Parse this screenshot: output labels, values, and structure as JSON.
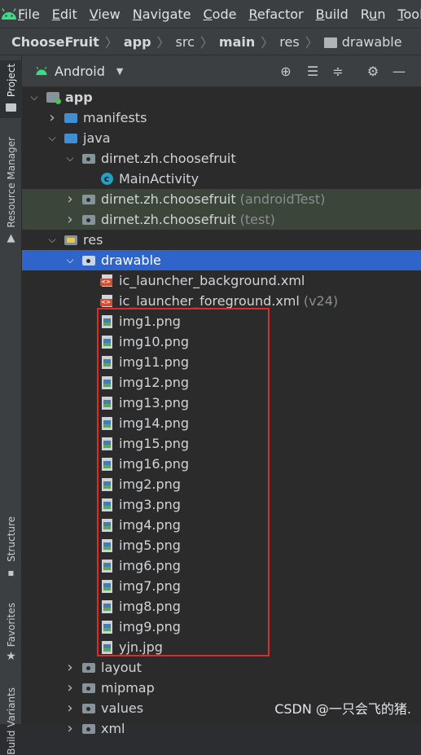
{
  "menubar": {
    "items": [
      {
        "pre": "",
        "u": "F",
        "post": "ile"
      },
      {
        "pre": "",
        "u": "E",
        "post": "dit"
      },
      {
        "pre": "",
        "u": "V",
        "post": "iew"
      },
      {
        "pre": "",
        "u": "N",
        "post": "avigate"
      },
      {
        "pre": "",
        "u": "C",
        "post": "ode"
      },
      {
        "pre": "",
        "u": "R",
        "post": "efactor"
      },
      {
        "pre": "",
        "u": "B",
        "post": "uild"
      },
      {
        "pre": "R",
        "u": "u",
        "post": "n"
      },
      {
        "pre": "",
        "u": "T",
        "post": "ools"
      }
    ]
  },
  "breadcrumb": [
    "ChooseFruit",
    "app",
    "src",
    "main",
    "res",
    "drawable"
  ],
  "side_tabs": {
    "project": "Project",
    "resource_manager": "Resource Manager",
    "structure": "Structure",
    "favorites": "Favorites",
    "variants": "Build Variants"
  },
  "project_view": {
    "selector": "Android"
  },
  "tree": [
    {
      "label": "app",
      "hint": "",
      "indent": 0,
      "arrow": "down",
      "icon": "module",
      "bold": true
    },
    {
      "label": "manifests",
      "hint": "",
      "indent": 1,
      "arrow": "right",
      "icon": "folder-blue"
    },
    {
      "label": "java",
      "hint": "",
      "indent": 1,
      "arrow": "down",
      "icon": "folder-blue"
    },
    {
      "label": "dirnet.zh.choosefruit",
      "hint": "",
      "indent": 2,
      "arrow": "down",
      "icon": "package"
    },
    {
      "label": "MainActivity",
      "hint": "",
      "indent": 3,
      "arrow": "none",
      "icon": "class"
    },
    {
      "label": "dirnet.zh.choosefruit",
      "hint": "(androidTest)",
      "indent": 2,
      "arrow": "right",
      "icon": "package",
      "test": true
    },
    {
      "label": "dirnet.zh.choosefruit",
      "hint": "(test)",
      "indent": 2,
      "arrow": "right",
      "icon": "package",
      "test": true
    },
    {
      "label": "res",
      "hint": "",
      "indent": 1,
      "arrow": "down",
      "icon": "folder-res"
    },
    {
      "label": "drawable",
      "hint": "",
      "indent": 2,
      "arrow": "down",
      "icon": "package",
      "selected": true
    },
    {
      "label": "ic_launcher_background.xml",
      "hint": "",
      "indent": 3,
      "arrow": "none",
      "icon": "xml"
    },
    {
      "label": "ic_launcher_foreground.xml",
      "hint": "(v24)",
      "indent": 3,
      "arrow": "none",
      "icon": "xml"
    },
    {
      "label": "img1.png",
      "hint": "",
      "indent": 3,
      "arrow": "none",
      "icon": "image"
    },
    {
      "label": "img10.png",
      "hint": "",
      "indent": 3,
      "arrow": "none",
      "icon": "image"
    },
    {
      "label": "img11.png",
      "hint": "",
      "indent": 3,
      "arrow": "none",
      "icon": "image"
    },
    {
      "label": "img12.png",
      "hint": "",
      "indent": 3,
      "arrow": "none",
      "icon": "image"
    },
    {
      "label": "img13.png",
      "hint": "",
      "indent": 3,
      "arrow": "none",
      "icon": "image"
    },
    {
      "label": "img14.png",
      "hint": "",
      "indent": 3,
      "arrow": "none",
      "icon": "image"
    },
    {
      "label": "img15.png",
      "hint": "",
      "indent": 3,
      "arrow": "none",
      "icon": "image"
    },
    {
      "label": "img16.png",
      "hint": "",
      "indent": 3,
      "arrow": "none",
      "icon": "image"
    },
    {
      "label": "img2.png",
      "hint": "",
      "indent": 3,
      "arrow": "none",
      "icon": "image"
    },
    {
      "label": "img3.png",
      "hint": "",
      "indent": 3,
      "arrow": "none",
      "icon": "image"
    },
    {
      "label": "img4.png",
      "hint": "",
      "indent": 3,
      "arrow": "none",
      "icon": "image"
    },
    {
      "label": "img5.png",
      "hint": "",
      "indent": 3,
      "arrow": "none",
      "icon": "image"
    },
    {
      "label": "img6.png",
      "hint": "",
      "indent": 3,
      "arrow": "none",
      "icon": "image"
    },
    {
      "label": "img7.png",
      "hint": "",
      "indent": 3,
      "arrow": "none",
      "icon": "image"
    },
    {
      "label": "img8.png",
      "hint": "",
      "indent": 3,
      "arrow": "none",
      "icon": "image"
    },
    {
      "label": "img9.png",
      "hint": "",
      "indent": 3,
      "arrow": "none",
      "icon": "image"
    },
    {
      "label": "yjn.jpg",
      "hint": "",
      "indent": 3,
      "arrow": "none",
      "icon": "image"
    },
    {
      "label": "layout",
      "hint": "",
      "indent": 2,
      "arrow": "right",
      "icon": "package"
    },
    {
      "label": "mipmap",
      "hint": "",
      "indent": 2,
      "arrow": "right",
      "icon": "package"
    },
    {
      "label": "values",
      "hint": "",
      "indent": 2,
      "arrow": "right",
      "icon": "package"
    },
    {
      "label": "xml",
      "hint": "",
      "indent": 2,
      "arrow": "right",
      "icon": "package"
    }
  ],
  "watermark": "CSDN @一只会飞的猪."
}
